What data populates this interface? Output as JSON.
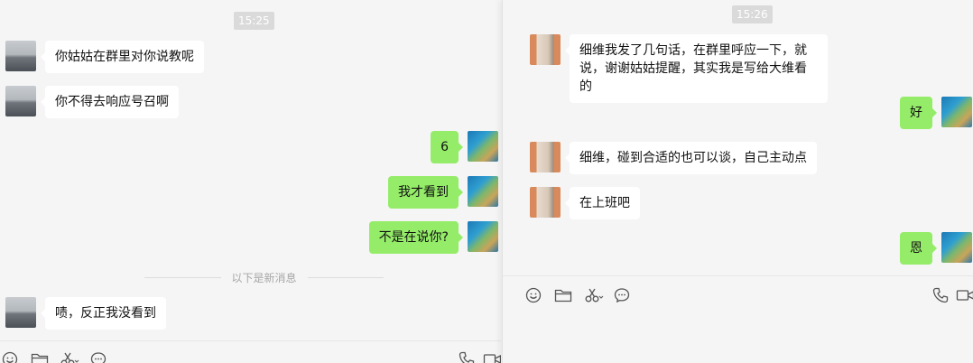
{
  "left_chat": {
    "timestamp": "15:25",
    "messages": [
      {
        "from": "them",
        "text": "你姑姑在群里对你说教呢"
      },
      {
        "from": "them",
        "text": "你不得去响应号召啊"
      },
      {
        "from": "me",
        "text": "6"
      },
      {
        "from": "me",
        "text": "我才看到"
      },
      {
        "from": "me",
        "text": "不是在说你?"
      }
    ],
    "new_messages_divider": "以下是新消息",
    "after_divider": [
      {
        "from": "them",
        "text": "啧，反正我没看到"
      }
    ],
    "toolbar_icons": [
      "emoji-icon",
      "folder-icon",
      "scissors-icon",
      "chat-bubble-icon",
      "phone-icon",
      "video-icon"
    ]
  },
  "right_chat": {
    "timestamp": "15:26",
    "messages": [
      {
        "from": "them",
        "text": "细维我发了几句话，在群里呼应一下，就说，谢谢姑姑提醒，其实我是写给大维看的"
      },
      {
        "from": "me",
        "text": "好"
      },
      {
        "from": "them",
        "text": "细维，碰到合适的也可以谈，自己主动点"
      },
      {
        "from": "them",
        "text": "在上班吧"
      },
      {
        "from": "me",
        "text": "恩"
      }
    ],
    "toolbar_icons": [
      "emoji-icon",
      "folder-icon",
      "scissors-icon",
      "chat-bubble-icon",
      "phone-icon",
      "video-icon"
    ]
  }
}
